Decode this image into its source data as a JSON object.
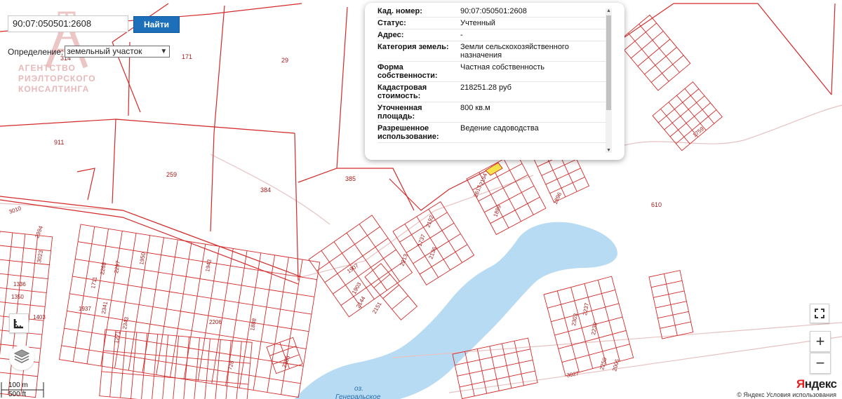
{
  "search": {
    "value": "90:07:050501:2608",
    "button_label": "Найти"
  },
  "definition": {
    "label": "Определение:",
    "selected": "земельный участок"
  },
  "watermark": {
    "line1": "АГЕНТСТВО",
    "line2": "РИЭЛТОРСКОГО",
    "line3": "КОНСАЛТИНГА"
  },
  "popup": {
    "rows": [
      {
        "key": "Кад. номер:",
        "value": "90:07:050501:2608"
      },
      {
        "key": "Статус:",
        "value": "Учтенный"
      },
      {
        "key": "Адрес:",
        "value": "-"
      },
      {
        "key": "Категория земель:",
        "value": "Земли сельскохозяйственного назначения"
      },
      {
        "key": "Форма собственности:",
        "value": "Частная собственность"
      },
      {
        "key": "Кадастровая стоимость:",
        "value": "218251.28 руб"
      },
      {
        "key": "Уточненная площадь:",
        "value": "800 кв.м"
      },
      {
        "key": "Разрешенное использование:",
        "value": "Ведение садоводства"
      }
    ]
  },
  "map": {
    "parcel_labels": [
      "314",
      "171",
      "29",
      "911",
      "259",
      "384",
      "385",
      "610",
      "3010",
      "2994",
      "3023",
      "1336",
      "1350",
      "1403",
      "1937",
      "2341",
      "2343",
      "1271",
      "2268",
      "1711",
      "2297",
      "1950",
      "1943",
      "2206",
      "1888",
      "726",
      "2355",
      "1907",
      "1903",
      "2144",
      "2151",
      "2213",
      "2136",
      "2192",
      "1737",
      "2154",
      "2613",
      "1899",
      "1896",
      "1759",
      "2303",
      "2237",
      "2239",
      "2250",
      "2005",
      "3027"
    ],
    "water_label_line1": "оз.",
    "water_label_line2": "Генеральское",
    "colors": {
      "parcel": "#d42a2a",
      "water": "#b7dbf3",
      "road": "#e7c2c2",
      "highlight": "#f6e24a"
    }
  },
  "controls": {
    "scale_100": "100 m",
    "scale_500": "500 ft",
    "zoom_in": "+",
    "zoom_out": "−",
    "fullscreen_icon": "fullscreen-icon",
    "layers_icon": "layers-icon",
    "ruler_icon": "ruler-icon"
  },
  "footer": {
    "copyright": "© Яндекс  Условия использования",
    "brand_y": "Я",
    "brand_rest": "ндекс"
  }
}
